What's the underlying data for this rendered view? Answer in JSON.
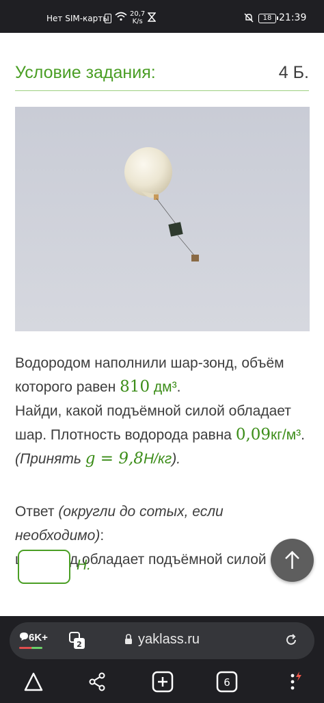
{
  "status_bar": {
    "carrier": "Нет SIM-карты",
    "sim_icon": "sim-icon",
    "speed_value": "20,7",
    "speed_unit": "K/s",
    "battery": "18",
    "time": "21:39"
  },
  "task": {
    "title": "Условие задания:",
    "points": "4 Б."
  },
  "problem": {
    "p1_a": "Водородом наполнили шар-зонд, объём которого равен ",
    "volume_value": "810",
    "volume_unit": "дм³",
    "p1_end": ".",
    "p2": "Найди, какой подъёмной силой обладает шар. Плотность водорода равна ",
    "density_value": "0,09",
    "density_unit": "кг/м³",
    "p2_end": ".",
    "p3_a": "(Принять ",
    "g_symbol": "g",
    "equals": " = ",
    "g_value": "9,8",
    "g_unit": "Н/кг",
    "p3_end": ")."
  },
  "answer": {
    "label": "Ответ ",
    "hint": "(округли до сотых, если необходимо)",
    "colon": ":",
    "line2": "шар-зонд обладает подъёмной силой",
    "input_value": "",
    "unit": "Н."
  },
  "browser": {
    "comment_count": "6K+",
    "tab_count": "2",
    "url": "yaklass.ru",
    "nav_tab_count": "6"
  },
  "colors": {
    "accent": "#4a9e24",
    "status_bar": "#1f1f23",
    "url_pill": "#35363a"
  }
}
